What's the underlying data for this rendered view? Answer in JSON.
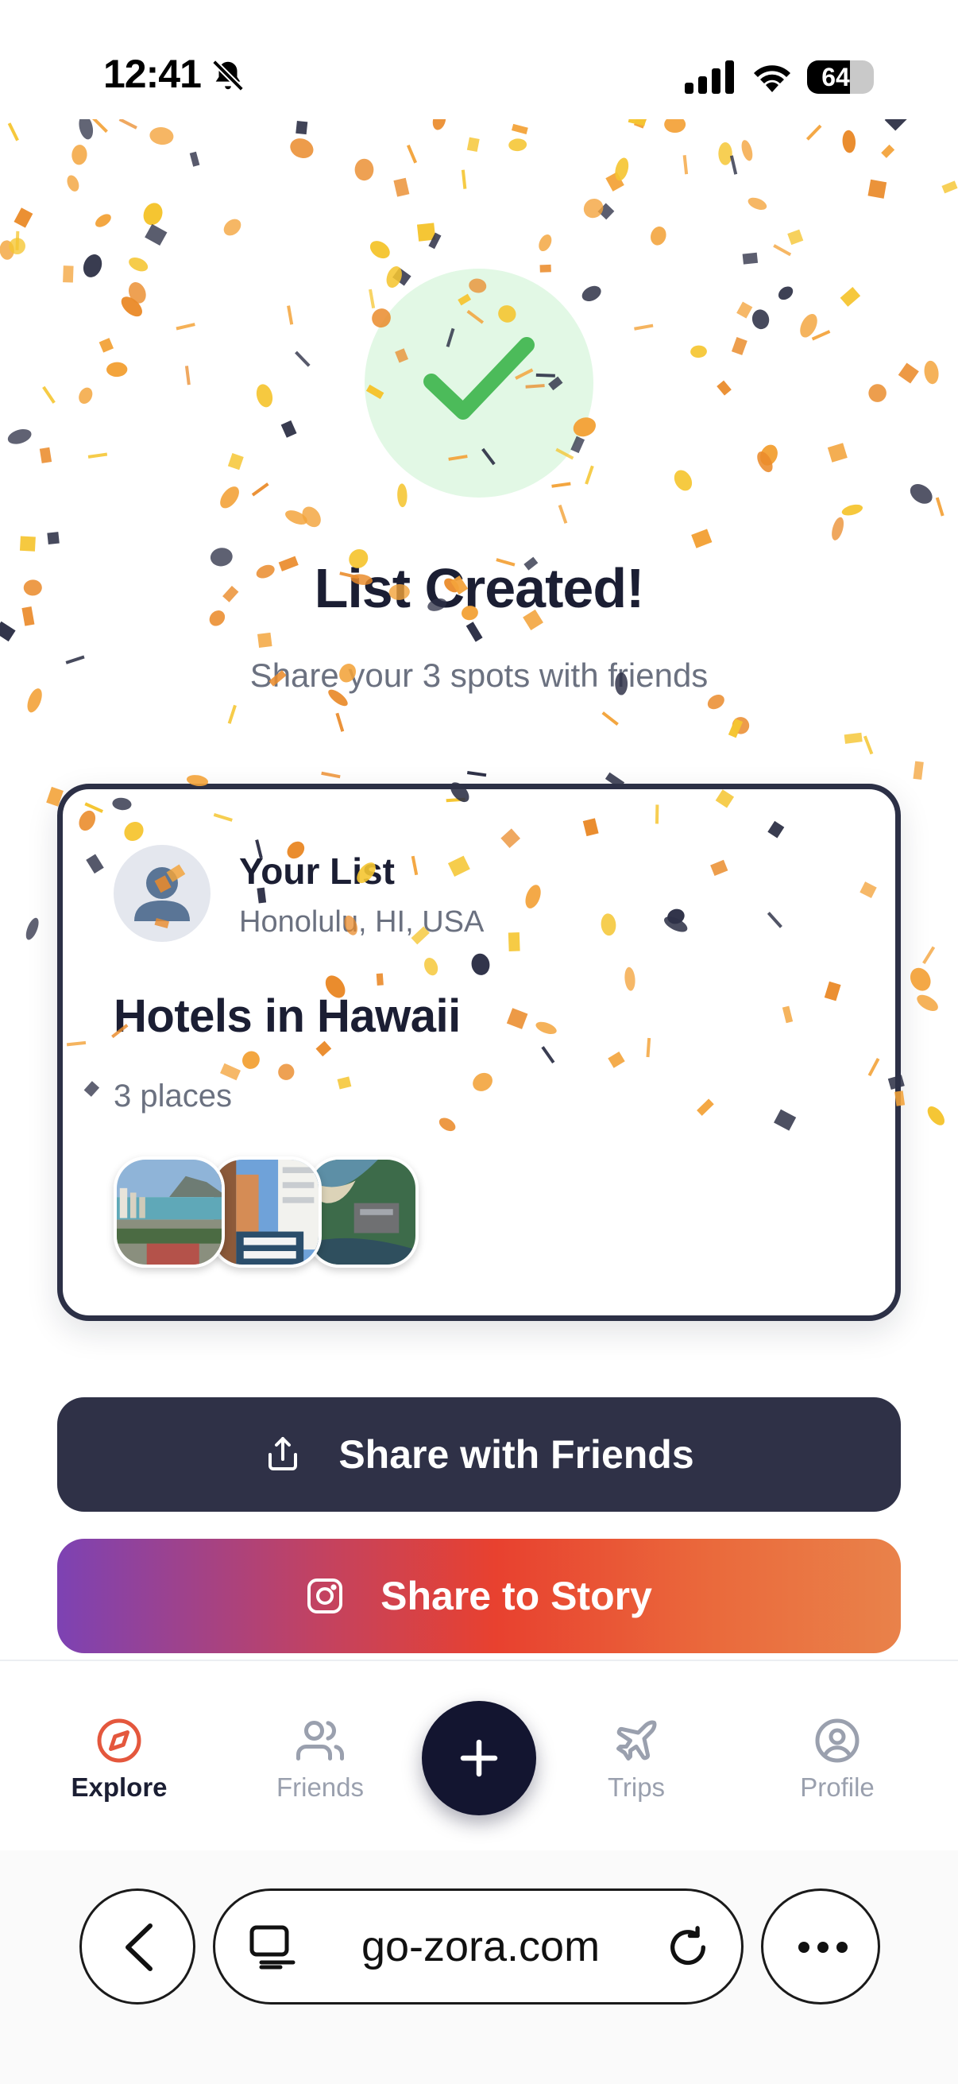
{
  "status_bar": {
    "time": "12:41",
    "battery": "64",
    "battery_level": 0.64
  },
  "hero": {
    "title": "List Created!",
    "subtitle": "Share your 3 spots with friends"
  },
  "list_card": {
    "owner_name": "Your List",
    "owner_location": "Honolulu, HI, USA",
    "title": "Hotels in Hawaii",
    "count": "3 places",
    "thumbnails": [
      "waikiki-beach-photo",
      "hotel-pool-photo",
      "resort-coast-photo"
    ]
  },
  "actions": {
    "share_friends": "Share with Friends",
    "share_story": "Share to Story"
  },
  "bottom_nav": {
    "items": [
      {
        "label": "Explore",
        "icon": "compass-icon",
        "active": true
      },
      {
        "label": "Friends",
        "icon": "users-icon",
        "active": false
      },
      {
        "label": "Trips",
        "icon": "plane-icon",
        "active": false
      },
      {
        "label": "Profile",
        "icon": "user-circle-icon",
        "active": false
      }
    ],
    "fab_icon": "plus-icon"
  },
  "browser": {
    "url": "go-zora.com"
  },
  "colors": {
    "primary": "#2f3147",
    "success": "#4cbb5a",
    "success_bg": "#e2f8e5",
    "confetti": [
      "#f3a33a",
      "#f5c531",
      "#ea8b2b",
      "#2e3147"
    ],
    "story_gradient": [
      "#7d42b3",
      "#e8412f",
      "#e9824a"
    ]
  }
}
